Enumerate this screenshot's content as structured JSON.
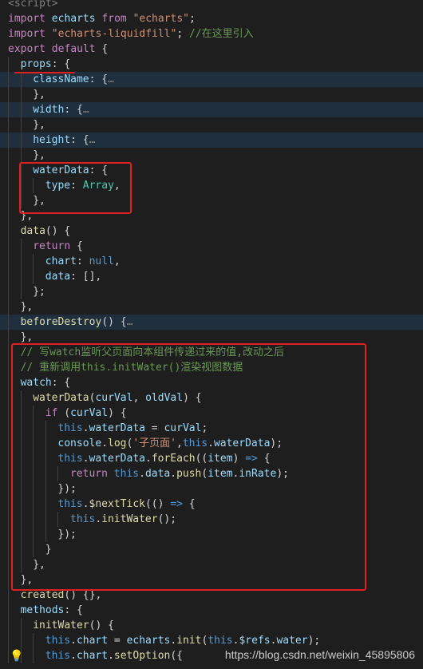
{
  "editor": {
    "lines": [
      {
        "tokens": [
          {
            "t": "<script>",
            "c": "tag"
          }
        ]
      },
      {
        "tokens": [
          {
            "t": "import",
            "c": "kw"
          },
          {
            "t": " echarts ",
            "c": "var"
          },
          {
            "t": "from",
            "c": "kw"
          },
          {
            "t": " ",
            "c": "pun"
          },
          {
            "t": "\"echarts\"",
            "c": "str"
          },
          {
            "t": ";",
            "c": "pun"
          }
        ]
      },
      {
        "tokens": [
          {
            "t": "import",
            "c": "kw"
          },
          {
            "t": " ",
            "c": "pun"
          },
          {
            "t": "\"echarts-liquidfill\"",
            "c": "str"
          },
          {
            "t": "; ",
            "c": "pun"
          },
          {
            "t": "//在这里引入",
            "c": "cmt"
          }
        ]
      },
      {
        "tokens": [
          {
            "t": "export",
            "c": "kw"
          },
          {
            "t": " ",
            "c": "pun"
          },
          {
            "t": "default",
            "c": "kw"
          },
          {
            "t": " {",
            "c": "pun"
          }
        ]
      },
      {
        "indent": 1,
        "tokens": [
          {
            "t": "props",
            "c": "prop"
          },
          {
            "t": ": {",
            "c": "pun"
          }
        ]
      },
      {
        "indent": 2,
        "hl": true,
        "tokens": [
          {
            "t": "className",
            "c": "prop"
          },
          {
            "t": ": {",
            "c": "pun"
          },
          {
            "t": "…",
            "c": "fold"
          }
        ]
      },
      {
        "indent": 2,
        "tokens": [
          {
            "t": "},",
            "c": "pun"
          }
        ]
      },
      {
        "indent": 2,
        "hl": true,
        "tokens": [
          {
            "t": "width",
            "c": "prop"
          },
          {
            "t": ": {",
            "c": "pun"
          },
          {
            "t": "…",
            "c": "fold"
          }
        ]
      },
      {
        "indent": 2,
        "tokens": [
          {
            "t": "},",
            "c": "pun"
          }
        ]
      },
      {
        "indent": 2,
        "hl": true,
        "tokens": [
          {
            "t": "height",
            "c": "prop"
          },
          {
            "t": ": {",
            "c": "pun"
          },
          {
            "t": "…",
            "c": "fold"
          }
        ]
      },
      {
        "indent": 2,
        "tokens": [
          {
            "t": "},",
            "c": "pun"
          }
        ]
      },
      {
        "indent": 2,
        "tokens": [
          {
            "t": "waterData",
            "c": "prop"
          },
          {
            "t": ": {",
            "c": "pun"
          }
        ]
      },
      {
        "indent": 3,
        "tokens": [
          {
            "t": "type",
            "c": "prop"
          },
          {
            "t": ": ",
            "c": "pun"
          },
          {
            "t": "Array",
            "c": "type"
          },
          {
            "t": ",",
            "c": "pun"
          }
        ]
      },
      {
        "indent": 2,
        "tokens": [
          {
            "t": "},",
            "c": "pun"
          }
        ]
      },
      {
        "indent": 1,
        "tokens": [
          {
            "t": "},",
            "c": "pun"
          }
        ]
      },
      {
        "indent": 1,
        "tokens": [
          {
            "t": "data",
            "c": "fn"
          },
          {
            "t": "() {",
            "c": "pun"
          }
        ]
      },
      {
        "indent": 2,
        "tokens": [
          {
            "t": "return",
            "c": "kw"
          },
          {
            "t": " {",
            "c": "pun"
          }
        ]
      },
      {
        "indent": 3,
        "tokens": [
          {
            "t": "chart",
            "c": "prop"
          },
          {
            "t": ": ",
            "c": "pun"
          },
          {
            "t": "null",
            "c": "bool"
          },
          {
            "t": ",",
            "c": "pun"
          }
        ]
      },
      {
        "indent": 3,
        "tokens": [
          {
            "t": "data",
            "c": "prop"
          },
          {
            "t": ": [],",
            "c": "pun"
          }
        ]
      },
      {
        "indent": 2,
        "tokens": [
          {
            "t": "};",
            "c": "pun"
          }
        ]
      },
      {
        "indent": 1,
        "tokens": [
          {
            "t": "},",
            "c": "pun"
          }
        ]
      },
      {
        "indent": 1,
        "hl": true,
        "tokens": [
          {
            "t": "beforeDestroy",
            "c": "fn"
          },
          {
            "t": "() {",
            "c": "pun"
          },
          {
            "t": "…",
            "c": "fold"
          }
        ]
      },
      {
        "indent": 1,
        "tokens": [
          {
            "t": "},",
            "c": "pun"
          }
        ]
      },
      {
        "indent": 1,
        "tokens": [
          {
            "t": "// 写watch监听父页面向本组件传递过来的值,改动之后",
            "c": "cmt"
          }
        ]
      },
      {
        "indent": 1,
        "tokens": [
          {
            "t": "// 重新调用this.initWater()渲染视图数据",
            "c": "cmt"
          }
        ]
      },
      {
        "indent": 1,
        "tokens": [
          {
            "t": "watch",
            "c": "prop"
          },
          {
            "t": ": {",
            "c": "pun"
          }
        ]
      },
      {
        "indent": 2,
        "tokens": [
          {
            "t": "waterData",
            "c": "fn"
          },
          {
            "t": "(",
            "c": "pun"
          },
          {
            "t": "curVal",
            "c": "var"
          },
          {
            "t": ", ",
            "c": "pun"
          },
          {
            "t": "oldVal",
            "c": "var"
          },
          {
            "t": ") {",
            "c": "pun"
          }
        ]
      },
      {
        "indent": 3,
        "tokens": [
          {
            "t": "if",
            "c": "kw"
          },
          {
            "t": " (",
            "c": "pun"
          },
          {
            "t": "curVal",
            "c": "var"
          },
          {
            "t": ") {",
            "c": "pun"
          }
        ]
      },
      {
        "indent": 4,
        "tokens": [
          {
            "t": "this",
            "c": "this"
          },
          {
            "t": ".",
            "c": "pun"
          },
          {
            "t": "waterData",
            "c": "prop"
          },
          {
            "t": " = ",
            "c": "pun"
          },
          {
            "t": "curVal",
            "c": "var"
          },
          {
            "t": ";",
            "c": "pun"
          }
        ]
      },
      {
        "indent": 4,
        "tokens": [
          {
            "t": "console",
            "c": "var"
          },
          {
            "t": ".",
            "c": "pun"
          },
          {
            "t": "log",
            "c": "fn"
          },
          {
            "t": "(",
            "c": "pun"
          },
          {
            "t": "'子页面'",
            "c": "str"
          },
          {
            "t": ",",
            "c": "pun"
          },
          {
            "t": "this",
            "c": "this"
          },
          {
            "t": ".",
            "c": "pun"
          },
          {
            "t": "waterData",
            "c": "prop"
          },
          {
            "t": ");",
            "c": "pun"
          }
        ]
      },
      {
        "indent": 4,
        "tokens": [
          {
            "t": "this",
            "c": "this"
          },
          {
            "t": ".",
            "c": "pun"
          },
          {
            "t": "waterData",
            "c": "prop"
          },
          {
            "t": ".",
            "c": "pun"
          },
          {
            "t": "forEach",
            "c": "fn"
          },
          {
            "t": "((",
            "c": "pun"
          },
          {
            "t": "item",
            "c": "var"
          },
          {
            "t": ") ",
            "c": "pun"
          },
          {
            "t": "=>",
            "c": "this"
          },
          {
            "t": " {",
            "c": "pun"
          }
        ]
      },
      {
        "indent": 5,
        "tokens": [
          {
            "t": "return",
            "c": "kw"
          },
          {
            "t": " ",
            "c": "pun"
          },
          {
            "t": "this",
            "c": "this"
          },
          {
            "t": ".",
            "c": "pun"
          },
          {
            "t": "data",
            "c": "prop"
          },
          {
            "t": ".",
            "c": "pun"
          },
          {
            "t": "push",
            "c": "fn"
          },
          {
            "t": "(",
            "c": "pun"
          },
          {
            "t": "item",
            "c": "var"
          },
          {
            "t": ".",
            "c": "pun"
          },
          {
            "t": "inRate",
            "c": "prop"
          },
          {
            "t": ");",
            "c": "pun"
          }
        ]
      },
      {
        "indent": 4,
        "tokens": [
          {
            "t": "});",
            "c": "pun"
          }
        ]
      },
      {
        "indent": 4,
        "tokens": [
          {
            "t": "this",
            "c": "this"
          },
          {
            "t": ".",
            "c": "pun"
          },
          {
            "t": "$nextTick",
            "c": "fn"
          },
          {
            "t": "(() ",
            "c": "pun"
          },
          {
            "t": "=>",
            "c": "this"
          },
          {
            "t": " {",
            "c": "pun"
          }
        ]
      },
      {
        "indent": 5,
        "tokens": [
          {
            "t": "this",
            "c": "this"
          },
          {
            "t": ".",
            "c": "pun"
          },
          {
            "t": "initWater",
            "c": "fn"
          },
          {
            "t": "();",
            "c": "pun"
          }
        ]
      },
      {
        "indent": 4,
        "tokens": [
          {
            "t": "});",
            "c": "pun"
          }
        ]
      },
      {
        "indent": 3,
        "tokens": [
          {
            "t": "}",
            "c": "pun"
          }
        ]
      },
      {
        "indent": 2,
        "tokens": [
          {
            "t": "},",
            "c": "pun"
          }
        ]
      },
      {
        "indent": 1,
        "tokens": [
          {
            "t": "},",
            "c": "pun"
          }
        ]
      },
      {
        "indent": 1,
        "tokens": [
          {
            "t": "created",
            "c": "fn"
          },
          {
            "t": "() {},",
            "c": "pun"
          }
        ]
      },
      {
        "indent": 1,
        "tokens": [
          {
            "t": "methods",
            "c": "prop"
          },
          {
            "t": ": {",
            "c": "pun"
          }
        ]
      },
      {
        "indent": 2,
        "tokens": [
          {
            "t": "initWater",
            "c": "fn"
          },
          {
            "t": "() {",
            "c": "pun"
          }
        ]
      },
      {
        "indent": 3,
        "tokens": [
          {
            "t": "this",
            "c": "this"
          },
          {
            "t": ".",
            "c": "pun"
          },
          {
            "t": "chart",
            "c": "prop"
          },
          {
            "t": " = ",
            "c": "pun"
          },
          {
            "t": "echarts",
            "c": "var"
          },
          {
            "t": ".",
            "c": "pun"
          },
          {
            "t": "init",
            "c": "fn"
          },
          {
            "t": "(",
            "c": "pun"
          },
          {
            "t": "this",
            "c": "this"
          },
          {
            "t": ".",
            "c": "pun"
          },
          {
            "t": "$refs",
            "c": "prop"
          },
          {
            "t": ".",
            "c": "pun"
          },
          {
            "t": "water",
            "c": "prop"
          },
          {
            "t": ");",
            "c": "pun"
          }
        ]
      },
      {
        "indent": 3,
        "tokens": [
          {
            "t": "this",
            "c": "this"
          },
          {
            "t": ".",
            "c": "pun"
          },
          {
            "t": "chart",
            "c": "prop"
          },
          {
            "t": ".",
            "c": "pun"
          },
          {
            "t": "setOption",
            "c": "fn"
          },
          {
            "t": "({",
            "c": "pun"
          }
        ]
      }
    ]
  },
  "watermark": "https://blog.csdn.net/weixin_45895806",
  "colors": {
    "background": "#1e1e1e",
    "annotation": "#e02020",
    "keyword": "#c586c0",
    "string": "#ce9178",
    "comment": "#6a9955",
    "property": "#9cdcfe",
    "function": "#dcdcaa",
    "this": "#569cd6",
    "type": "#4ec9b0"
  },
  "icons": {
    "lightbulb": "lightbulb-icon"
  }
}
